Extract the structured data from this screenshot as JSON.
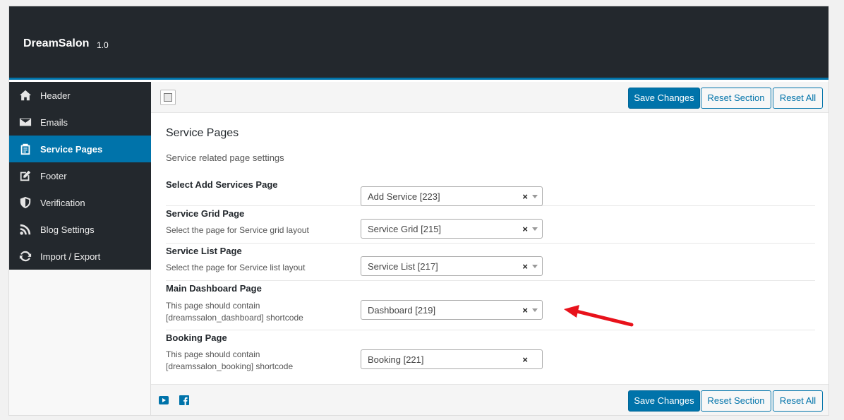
{
  "app": {
    "name": "DreamSalon",
    "version": "1.0"
  },
  "sidebar": {
    "items": [
      {
        "label": "Header",
        "icon": "home-icon",
        "active": false
      },
      {
        "label": "Emails",
        "icon": "envelope-icon",
        "active": false
      },
      {
        "label": "Service Pages",
        "icon": "clipboard-icon",
        "active": true
      },
      {
        "label": "Footer",
        "icon": "edit-icon",
        "active": false
      },
      {
        "label": "Verification",
        "icon": "shield-icon",
        "active": false
      },
      {
        "label": "Blog Settings",
        "icon": "rss-icon",
        "active": false
      },
      {
        "label": "Import / Export",
        "icon": "refresh-icon",
        "active": false
      }
    ]
  },
  "toolbar": {
    "save_label": "Save Changes",
    "reset_section_label": "Reset Section",
    "reset_all_label": "Reset All"
  },
  "section": {
    "title": "Service Pages",
    "description": "Service related page settings",
    "fields": [
      {
        "label": "Select Add Services Page",
        "description": "",
        "value": "Add Service [223]"
      },
      {
        "label": "Service Grid Page",
        "description": "Select the page for Service grid layout",
        "value": "Service Grid [215]"
      },
      {
        "label": "Service List Page",
        "description": "Select the page for Service list layout",
        "value": "Service List [217]"
      },
      {
        "label": "Main Dashboard Page",
        "description": "This page should contain [dreamssalon_dashboard] shortcode",
        "value": "Dashboard [219]"
      },
      {
        "label": "Booking Page",
        "description": "This page should contain [dreamssalon_booking] shortcode",
        "value": "Booking [221]"
      }
    ]
  },
  "select_clear_glyph": "×",
  "colors": {
    "accent": "#0073aa",
    "header_bg": "#23282d",
    "annotation": "#e8121b"
  },
  "footer": {
    "icons": [
      "youtube-icon",
      "facebook-icon"
    ]
  }
}
